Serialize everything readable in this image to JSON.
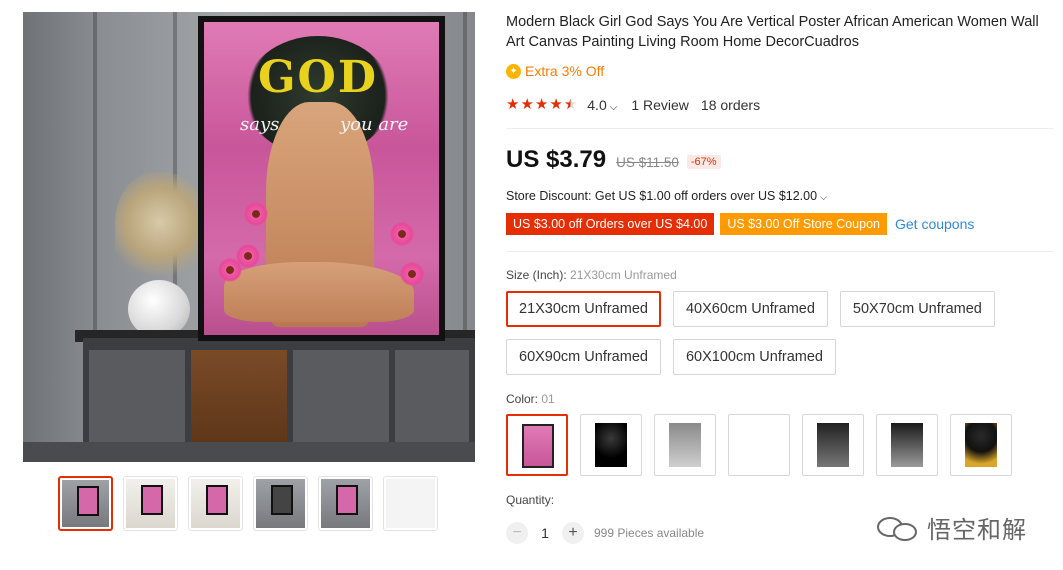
{
  "product": {
    "title": "Modern Black Girl God Says You Are Vertical Poster African American Women Wall Art Canvas Painting Living Room Home DecorCuadros",
    "extra_off": "Extra 3% Off",
    "rating": "4.0",
    "rating_stars": 4.0,
    "reviews": "1 Review",
    "orders": "18 orders"
  },
  "price": {
    "current": "US $3.79",
    "original": "US $11.50",
    "discount": "-67%"
  },
  "store_discount": "Store Discount: Get US $1.00 off orders over US $12.00",
  "coupons": {
    "coupon_1": "US $3.00 off Orders over US $4.00",
    "coupon_2": "US $3.00 Off Store Coupon",
    "get_coupons": "Get coupons"
  },
  "size": {
    "label": "Size (Inch):",
    "selected_value": "21X30cm Unframed",
    "options": [
      "21X30cm Unframed",
      "40X60cm Unframed",
      "50X70cm Unframed",
      "60X90cm Unframed",
      "60X100cm Unframed"
    ]
  },
  "color": {
    "label": "Color:",
    "selected_value": "01"
  },
  "quantity": {
    "label": "Quantity:",
    "value": "1",
    "available": "999 Pieces available"
  },
  "poster_art": {
    "word": "GOD",
    "says": "says",
    "you_are": "you are"
  },
  "watermark": "悟空和解",
  "colors": {
    "accent_red": "#e62e04",
    "coupon_orange": "#ff9a00",
    "link_blue": "#2f8adb",
    "extra_off_orange": "#ff7a00"
  }
}
